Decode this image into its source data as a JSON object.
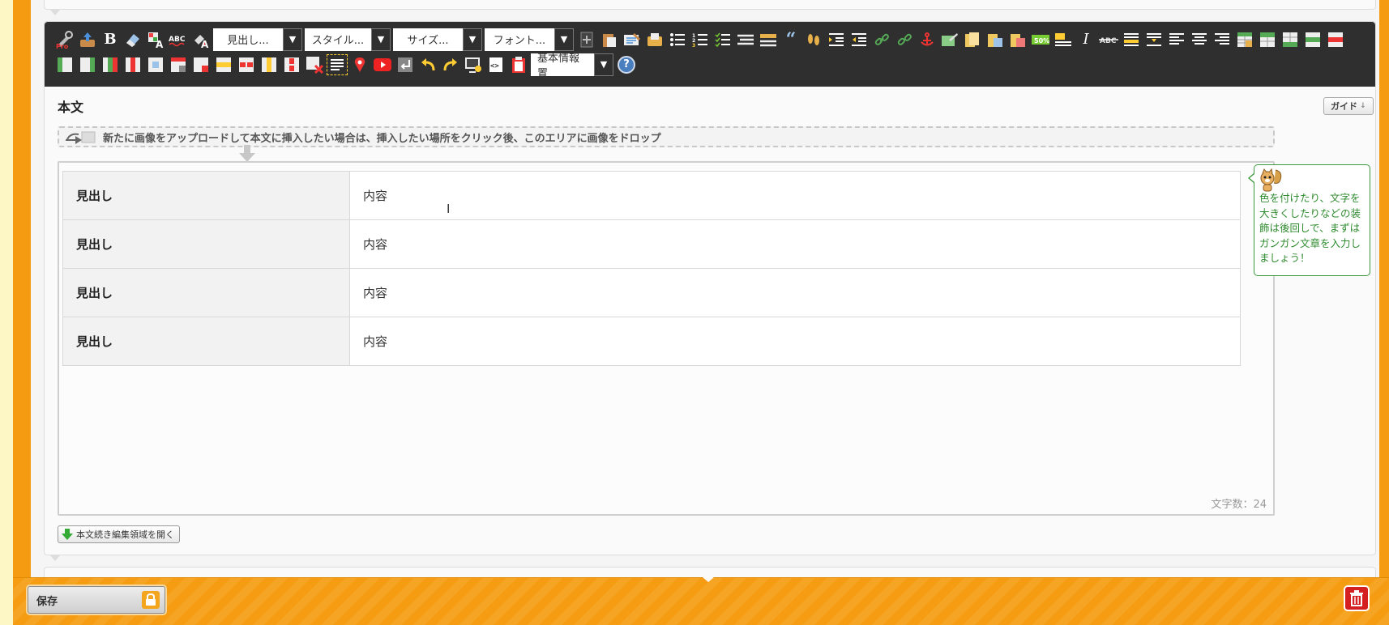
{
  "toolbar": {
    "row1_selects": [
      "見出し...",
      "スタイル...",
      "サイズ...",
      "フォント..."
    ],
    "row2_select": "基本情報置",
    "help_label": "?",
    "bold_label": "B",
    "italic_label": "I",
    "spell_label": "ABC"
  },
  "editor": {
    "section_title": "本文",
    "guide_label": "ガイド",
    "drop_zone_text": "新たに画像をアップロードして本文に挿入したい場合は、挿入したい場所をクリック後、このエリアに画像をドロップ",
    "table_rows": [
      {
        "heading": "見出し",
        "content": "内容"
      },
      {
        "heading": "見出し",
        "content": "内容"
      },
      {
        "heading": "見出し",
        "content": "内容"
      },
      {
        "heading": "見出し",
        "content": "内容"
      }
    ],
    "char_count": "文字数：24",
    "open_more_label": "本文続き編集領域を開く"
  },
  "tip": {
    "text": "色を付けたり、文字を大きくしたりなどの装飾は後回しで、まずはガンガン文章を入力しましょう！"
  },
  "footer": {
    "save_label": "保存"
  },
  "colors": {
    "accent_orange": "#f49b12",
    "toolbar_bg": "#2f2f2f",
    "tip_green": "#2e8b2e",
    "delete_red": "#d42020"
  }
}
